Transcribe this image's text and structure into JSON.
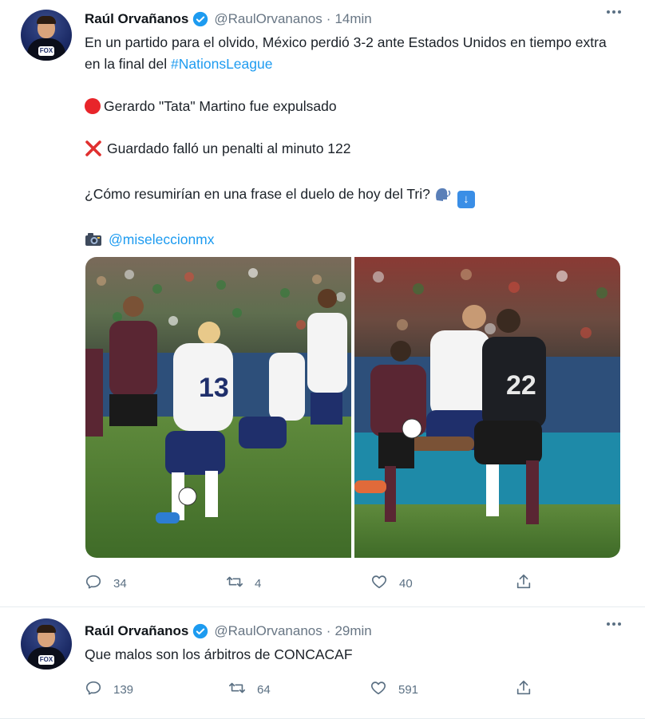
{
  "tweets": [
    {
      "author_name": "Raúl Orvañanos",
      "handle": "@RaulOrvananos",
      "separator": "·",
      "time": "14min",
      "text": {
        "line1_before": "En un partido para el olvido, México perdió 3-2 ante Estados Unidos en tiempo extra en la final del ",
        "hashtag": "#NationsLeague",
        "line2": "Gerardo \"Tata\" Martino fue expulsado",
        "line3": "Guardado falló un penalti al minuto 122",
        "line4": "¿Cómo resumirían en una frase el duelo de hoy del Tri?",
        "mention": "@miseleccionmx"
      },
      "actions": {
        "replies": "34",
        "retweets": "4",
        "likes": "40"
      }
    },
    {
      "author_name": "Raúl Orvañanos",
      "handle": "@RaulOrvananos",
      "separator": "·",
      "time": "29min",
      "text": "Que malos son los árbitros de CONCACAF",
      "actions": {
        "replies": "139",
        "retweets": "64",
        "likes": "591"
      }
    }
  ],
  "photos": {
    "left_jersey_number": "13",
    "right_jersey_number": "22"
  },
  "avatar_badge": "FOX",
  "colors": {
    "link": "#1d9bf0",
    "verified": "#1d9bf0",
    "muted": "#5b7083"
  },
  "icons": {
    "verified": "verified-badge-icon",
    "more": "more-dots-icon",
    "reply": "reply-icon",
    "retweet": "retweet-icon",
    "like": "heart-icon",
    "share": "share-icon",
    "red_circle": "red-circle-emoji",
    "cross": "cross-mark-emoji",
    "speech": "speaking-head-emoji",
    "down_arrow": "down-arrow-emoji",
    "camera": "camera-emoji"
  }
}
